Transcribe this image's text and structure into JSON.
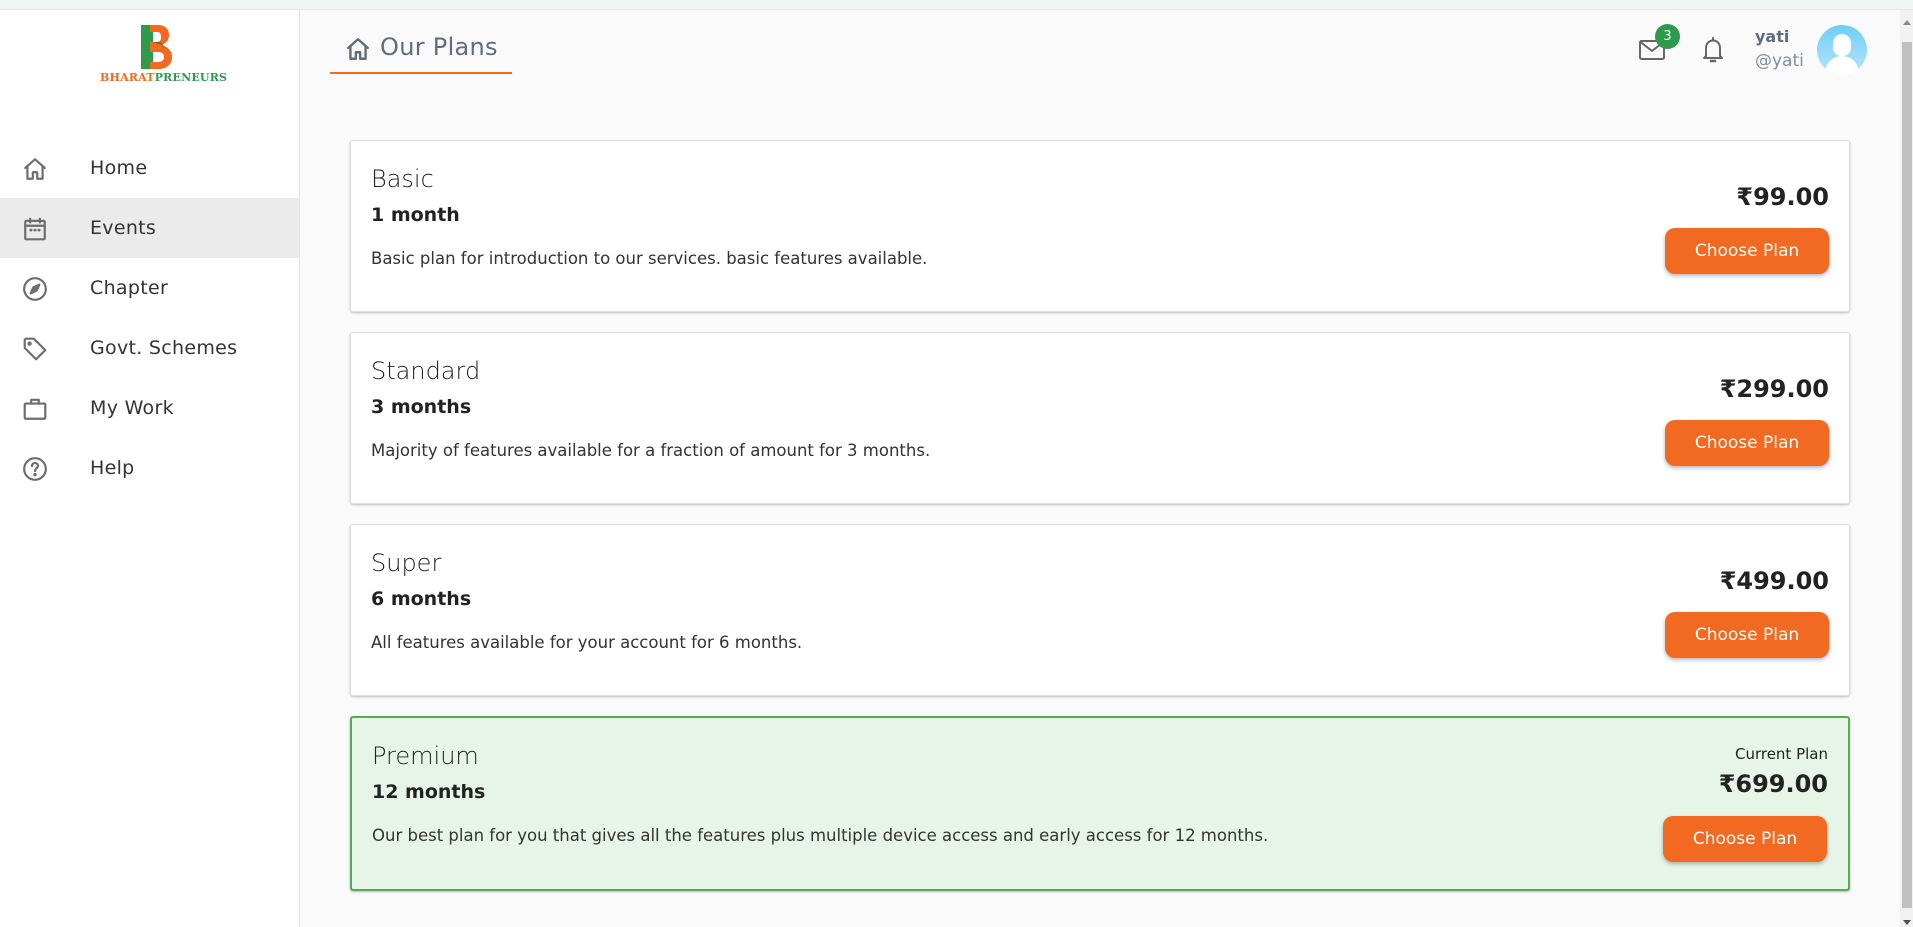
{
  "brand": {
    "logo_letter": "B",
    "name_part1": "BHARAT",
    "name_part2": "PRENEURS",
    "colors": {
      "orange": "#f26a22",
      "green": "#2e9a4c"
    }
  },
  "sidebar": {
    "items": [
      {
        "label": "Home",
        "icon": "home-icon",
        "active": false
      },
      {
        "label": "Events",
        "icon": "calendar-icon",
        "active": true
      },
      {
        "label": "Chapter",
        "icon": "compass-icon",
        "active": false
      },
      {
        "label": "Govt. Schemes",
        "icon": "tag-icon",
        "active": false
      },
      {
        "label": "My Work",
        "icon": "briefcase-icon",
        "active": false
      },
      {
        "label": "Help",
        "icon": "help-circle-icon",
        "active": false
      }
    ]
  },
  "header": {
    "title": "Our Plans",
    "title_icon": "home-icon",
    "mail_badge_count": "3",
    "user": {
      "name": "yati",
      "handle": "@yati"
    }
  },
  "plans": [
    {
      "name": "Basic",
      "duration": "1 month",
      "description": "Basic plan for introduction to our services. basic features available.",
      "price": "₹99.00",
      "button": "Choose Plan",
      "current": false
    },
    {
      "name": "Standard",
      "duration": "3 months",
      "description": "Majority of features available for a fraction of amount for 3 months.",
      "price": "₹299.00",
      "button": "Choose Plan",
      "current": false
    },
    {
      "name": "Super",
      "duration": "6 months",
      "description": "All features available for your account for 6 months.",
      "price": "₹499.00",
      "button": "Choose Plan",
      "current": false
    },
    {
      "name": "Premium",
      "duration": "12 months",
      "description": "Our best plan for you that gives all the features plus multiple device access and early access for 12 months.",
      "price": "₹699.00",
      "button": "Choose Plan",
      "current": true,
      "current_label": "Current Plan"
    }
  ],
  "colors": {
    "accent": "#f26a22",
    "current_plan_bg": "#e7f5e8",
    "current_plan_border": "#4caf50",
    "badge": "#2e9a4c"
  }
}
